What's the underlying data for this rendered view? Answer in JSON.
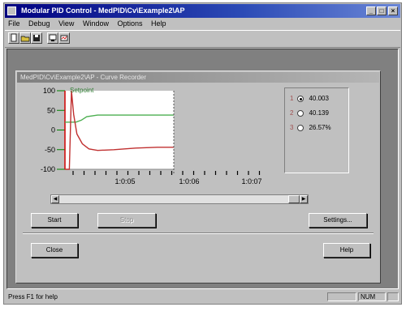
{
  "window": {
    "title": "Modular PID Control - MedPID\\Cv\\Example2\\AP"
  },
  "menu": [
    "File",
    "Debug",
    "View",
    "Window",
    "Options",
    "Help"
  ],
  "child": {
    "title": "MedPID\\Cv\\Example2\\AP - Curve Recorder"
  },
  "chart_data": {
    "type": "line",
    "title": "",
    "series": [
      {
        "name": "Setpoint",
        "color": "#4caf50",
        "x": [
          0,
          5,
          10,
          15,
          20,
          30,
          40,
          60,
          80,
          100
        ],
        "values": [
          20,
          20,
          20,
          25,
          34,
          38,
          38,
          38,
          38,
          38
        ]
      },
      {
        "color": "#c03030",
        "x": [
          0,
          1,
          4,
          6,
          8,
          11,
          16,
          22,
          30,
          45,
          65,
          85,
          100
        ],
        "values": [
          -100,
          -100,
          -100,
          100,
          40,
          -10,
          -35,
          -48,
          -52,
          -50,
          -46,
          -44,
          -44
        ]
      }
    ],
    "xlim": [
      0,
      100
    ],
    "ylim": [
      -100,
      100
    ],
    "yticks": [
      "100",
      "50",
      "0",
      "-50",
      "-100"
    ],
    "xticks": [
      "1:0:05",
      "1:0:06",
      "1:0:07"
    ],
    "cursor_x": 100,
    "colors": {
      "axis": "#d00000",
      "ticks": "#008000"
    }
  },
  "legend": [
    {
      "idx": "1",
      "value": "40.003",
      "selected": true
    },
    {
      "idx": "2",
      "value": "40.139",
      "selected": false
    },
    {
      "idx": "3",
      "value": "26.57%",
      "selected": false
    }
  ],
  "buttons": {
    "start": "Start",
    "stop": "Stop",
    "settings": "Settings...",
    "close": "Close",
    "help": "Help"
  },
  "status": {
    "text": "Press F1 for help",
    "num": "NUM"
  }
}
